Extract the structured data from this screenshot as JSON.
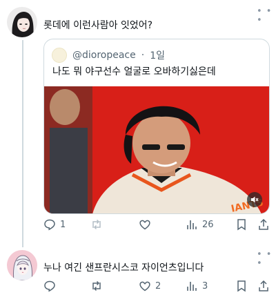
{
  "post1": {
    "text": "롯데에 이런사람아 잇었어?",
    "more_icon": "more-dots-icon"
  },
  "quote": {
    "handle": "@dioropeace",
    "separator": "·",
    "time": "1일",
    "text": "나도 뭐 야구선수 얼굴로 오바하기싫은데",
    "media_icon": "volume-mute-icon"
  },
  "post1_actions": {
    "reply_count": "1",
    "repost_count": "",
    "like_count": "",
    "views_count": "26"
  },
  "post2": {
    "text": "누나 여긴 샌프란시스코 자이언츠입니다",
    "more_icon": "more-dots-icon"
  },
  "post2_actions": {
    "reply_count": "",
    "repost_count": "",
    "like_count": "2",
    "views_count": "3"
  },
  "colors": {
    "text": "#0f1419",
    "secondary": "#536471",
    "border": "#cfd9de",
    "media_bg": "#d81f18"
  }
}
